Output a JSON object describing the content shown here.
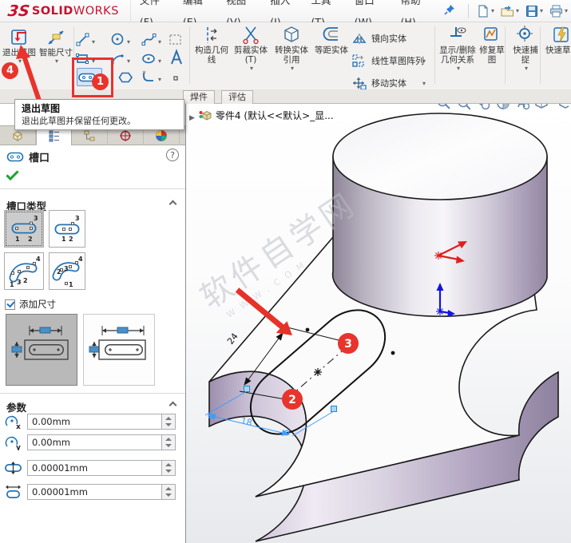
{
  "menu_bar": {
    "logo": {
      "mark": "3S",
      "bold": "SOLID",
      "light": "WORKS"
    },
    "items": [
      "文件(F)",
      "编辑(E)",
      "视图(V)",
      "插入(I)",
      "工具(T)",
      "窗口(W)",
      "帮助(H)"
    ]
  },
  "ribbon": {
    "exit_sketch": "退出草图",
    "smart_dimension": "智能尺寸",
    "construction_geometry": "构造几何线",
    "trim_entities": "剪裁实体(T)",
    "convert_entities": "转换实体引用",
    "offset_entities": "等距实体",
    "mirror_entities": "镜向实体",
    "linear_sketch_pattern": "线性草图阵列",
    "move_entities": "移动实体",
    "display_delete_relations": "显示/删除几何关系",
    "repair_sketch": "修复草图",
    "quick_snaps": "快速捕捉",
    "rapid_sketch": "快速草图"
  },
  "command_tabs": [
    "焊件",
    "评估"
  ],
  "tooltip": {
    "title": "退出草图",
    "description": "退出此草图并保留任何更改。"
  },
  "callouts": {
    "step1": "1",
    "step2": "2",
    "step3": "3",
    "step4": "4"
  },
  "property_manager": {
    "title": "槽口",
    "slot_type_label": "槽口类型",
    "add_dimensions_label": "添加尺寸",
    "parameters_label": "参数",
    "axis": [
      "x",
      "y"
    ],
    "slot_point_labels": [
      "1",
      "2",
      "3",
      "4"
    ],
    "parameters": [
      {
        "name": "center-x",
        "value": "0.00mm"
      },
      {
        "name": "center-y",
        "value": "0.00mm"
      },
      {
        "name": "slot-width",
        "value": "0.00001mm"
      },
      {
        "name": "slot-length",
        "value": "0.00001mm"
      }
    ]
  },
  "viewport": {
    "feature_tree_item": "零件4 (默认<<默认>_显...",
    "watermark": "软件自学网",
    "watermark_sub": "WWW.COM",
    "sketch_dims": [
      "24",
      "18"
    ]
  }
}
